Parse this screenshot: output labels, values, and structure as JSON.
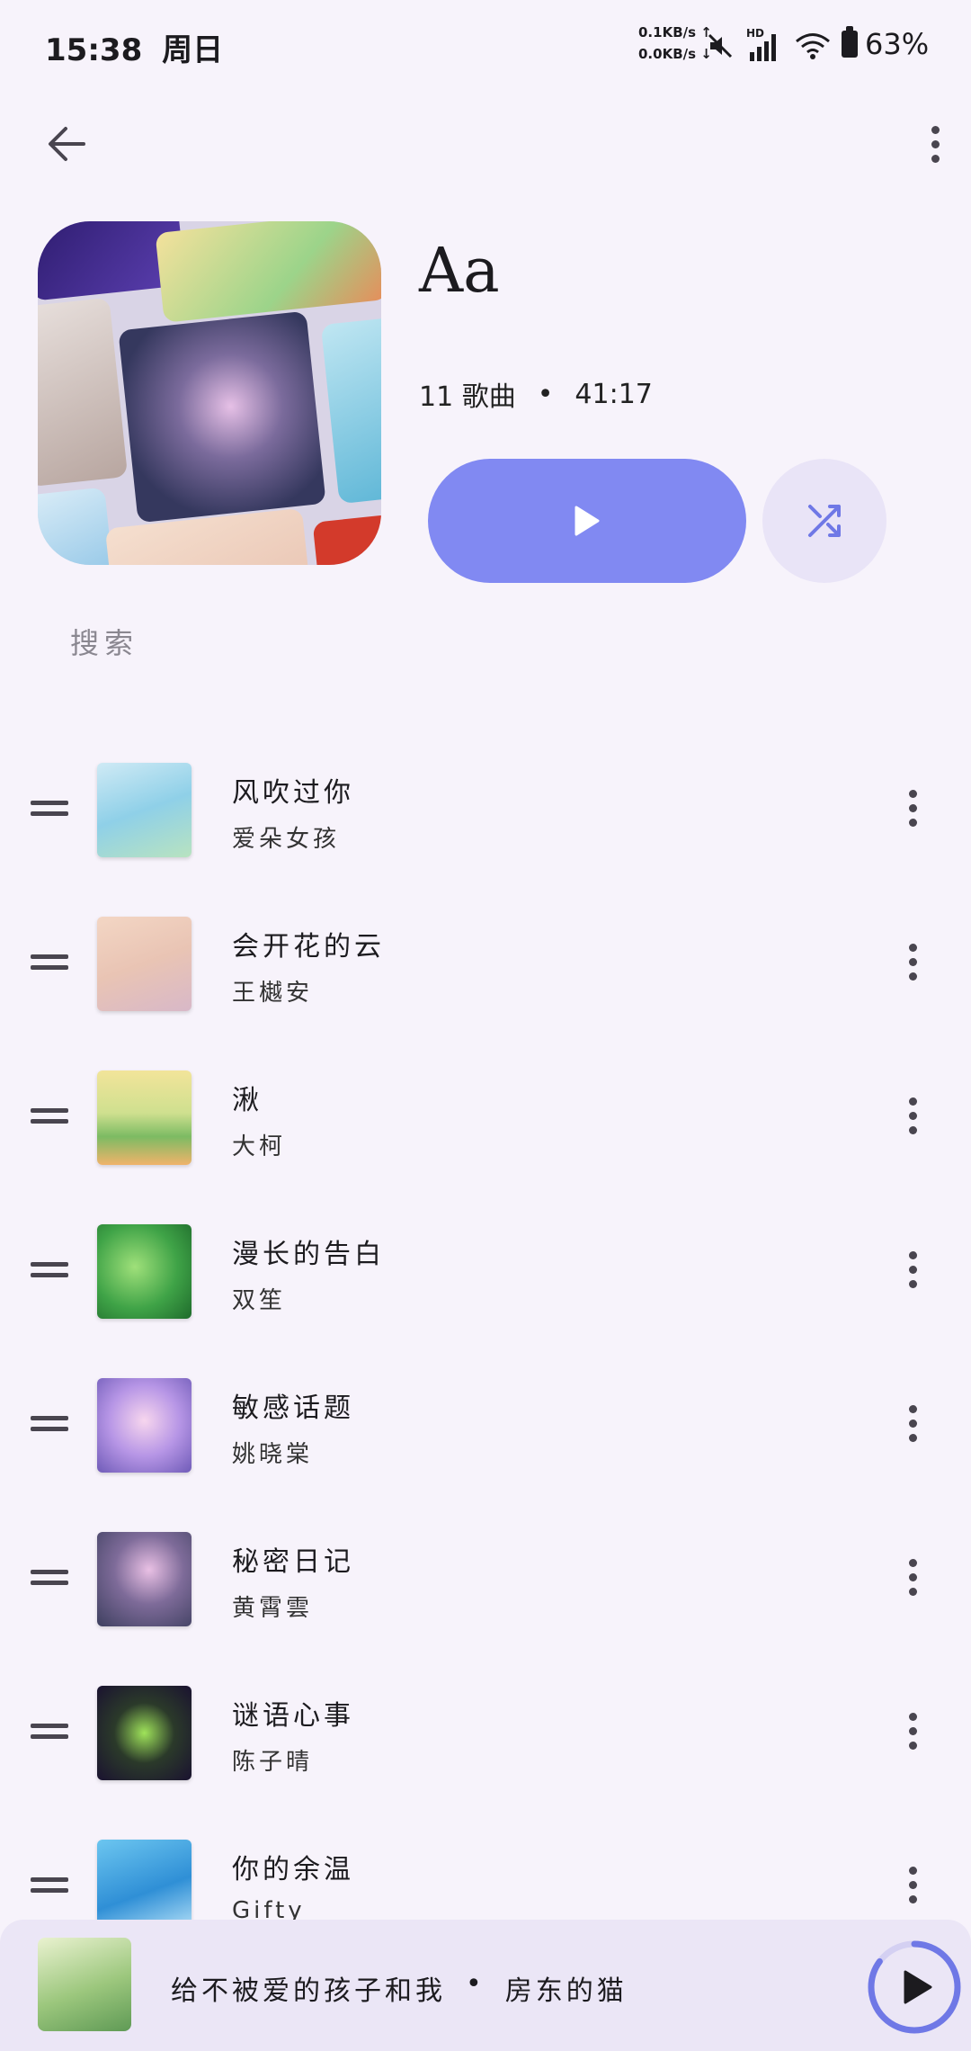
{
  "status_bar": {
    "time": "15:38",
    "day": "周日",
    "net_up": "0.1KB/s ↑",
    "net_down": "0.0KB/s ↓",
    "hd": "HD",
    "battery": "63%"
  },
  "playlist": {
    "title": "Aa",
    "song_count": "11 歌曲",
    "separator": "•",
    "duration": "41:17",
    "search_placeholder": "搜索"
  },
  "songs": [
    {
      "title": "风吹过你",
      "artist": "爱朵女孩"
    },
    {
      "title": "会开花的云",
      "artist": "王樾安"
    },
    {
      "title": "湫",
      "artist": "大柯"
    },
    {
      "title": "漫长的告白",
      "artist": "双笙"
    },
    {
      "title": "敏感话题",
      "artist": "姚晓棠"
    },
    {
      "title": "秘密日记",
      "artist": "黄霄雲"
    },
    {
      "title": "谜语心事",
      "artist": "陈子晴"
    },
    {
      "title": "你的余温",
      "artist": "Gifty"
    }
  ],
  "mini_player": {
    "song": "给不被爱的孩子和我",
    "separator": "•",
    "artist": "房东的猫",
    "progress": 0.85
  },
  "colors": {
    "accent": "#8189f2",
    "secondary_button": "#e9e4f7",
    "background": "#f7f3fb"
  }
}
